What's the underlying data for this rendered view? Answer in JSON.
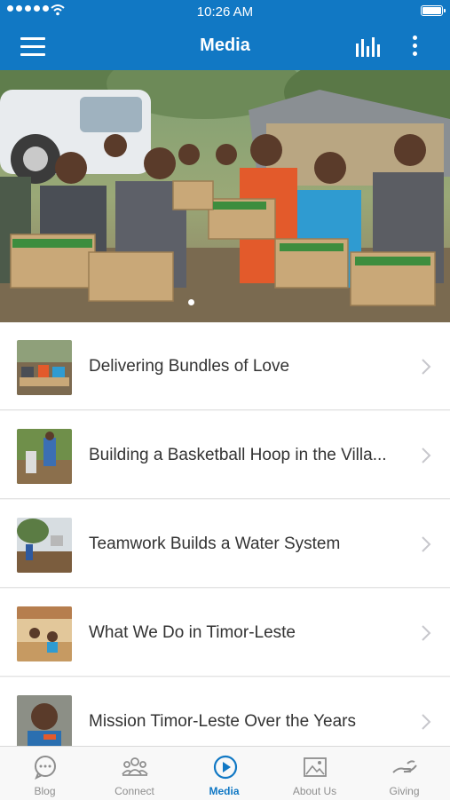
{
  "status_bar": {
    "time": "10:26 AM"
  },
  "nav": {
    "title": "Media",
    "menu_icon": "hamburger-menu-icon",
    "stats_icon": "bar-chart-icon",
    "more_icon": "more-vertical-icon"
  },
  "hero": {
    "description": "Children holding boxes",
    "active_page": 1
  },
  "items": [
    {
      "title": "Delivering Bundles of Love"
    },
    {
      "title": "Building a Basketball Hoop in the Villa..."
    },
    {
      "title": "Teamwork Builds a Water System"
    },
    {
      "title": "What We Do in Timor-Leste"
    },
    {
      "title": "Mission Timor-Leste Over the Years"
    }
  ],
  "tabs": [
    {
      "label": "Blog",
      "icon": "chat-bubble-icon"
    },
    {
      "label": "Connect",
      "icon": "people-icon"
    },
    {
      "label": "Media",
      "icon": "play-circle-icon",
      "active": true
    },
    {
      "label": "About Us",
      "icon": "picture-icon"
    },
    {
      "label": "Giving",
      "icon": "giving-hand-icon"
    }
  ],
  "colors": {
    "primary": "#1178c4",
    "tab_inactive": "#8e8e8e",
    "text": "#333333"
  }
}
